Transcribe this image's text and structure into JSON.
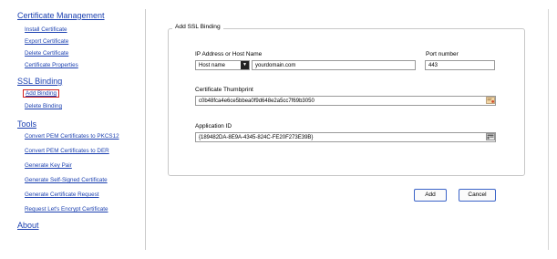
{
  "sidebar": {
    "certificate_management": {
      "title": "Certificate Management",
      "items": [
        "Install Certificate",
        "Export Certificate",
        "Delete Certificate",
        "Certificate Properties"
      ]
    },
    "ssl_binding": {
      "title": "SSL Binding",
      "items": [
        "Add Binding",
        "Delete Binding"
      ],
      "selected": "Add Binding"
    },
    "tools": {
      "title": "Tools",
      "items": [
        "Convert PEM Certificates to PKCS12",
        "Convert PEM Certificates to DER",
        "Generate Key Pair",
        "Generate Self-Signed Certificate",
        "Generate Certificate Request",
        "Request Let's Encrypt Certificate"
      ]
    },
    "about": {
      "title": "About"
    }
  },
  "form": {
    "legend": "Add SSL Binding",
    "ip_label": "IP Address or Host Name",
    "host_type": "Host name",
    "host_value": "yourdomain.com",
    "port_label": "Port number",
    "port_value": "443",
    "thumb_label": "Certificate Thumbprint",
    "thumb_value": "c0b48fca4e6ce5bbea0f9d648e2a5cc7f69b3050",
    "app_label": "Application ID",
    "app_value": "{189482DA-8E9A-4345-824C-FE20F273E39B}",
    "add_label": "Add",
    "cancel_label": "Cancel"
  }
}
